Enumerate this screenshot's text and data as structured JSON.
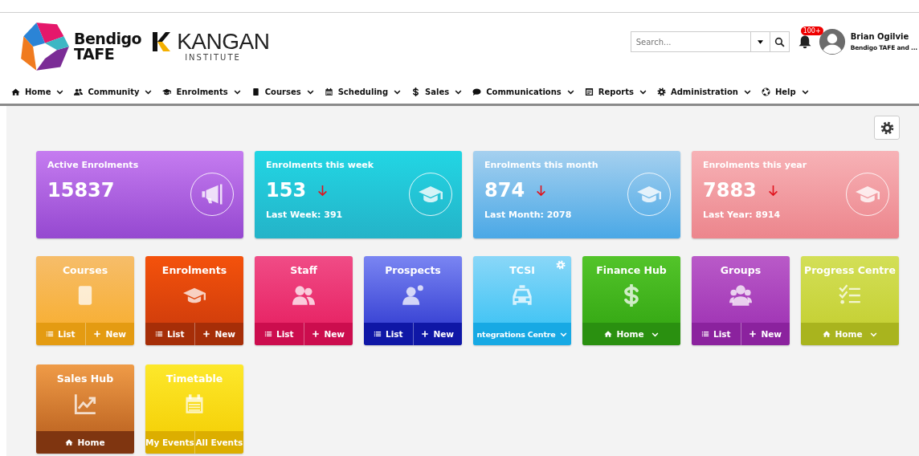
{
  "header": {
    "brand_primary": [
      "Bendigo",
      "TAFE"
    ],
    "brand_secondary": {
      "name": "KANGAN",
      "sub": "INSTITUTE"
    },
    "search": {
      "placeholder": "Search..."
    },
    "notifications": {
      "badge": "100+"
    },
    "user": {
      "name": "Brian Ogilvie",
      "organisation": "Bendigo TAFE and ..."
    }
  },
  "nav": [
    {
      "label": "Home"
    },
    {
      "label": "Community"
    },
    {
      "label": "Enrolments"
    },
    {
      "label": "Courses"
    },
    {
      "label": "Scheduling"
    },
    {
      "label": "Sales"
    },
    {
      "label": "Communications"
    },
    {
      "label": "Reports"
    },
    {
      "label": "Administration"
    },
    {
      "label": "Help"
    }
  ],
  "stats": [
    {
      "title": "Active Enrolments",
      "value": "15837",
      "falling": false
    },
    {
      "title": "Enrolments this week",
      "value": "153",
      "falling": true,
      "previous": "Last Week: 391"
    },
    {
      "title": "Enrolments this month",
      "value": "874",
      "falling": true,
      "previous": "Last Month: 2078"
    },
    {
      "title": "Enrolments this year",
      "value": "7883",
      "falling": true,
      "previous": "Last Year: 8914"
    }
  ],
  "tiles": [
    {
      "title": "Courses",
      "settings": false,
      "actions": [
        {
          "kind": "list",
          "label": "List"
        },
        {
          "kind": "new",
          "label": "New"
        }
      ]
    },
    {
      "title": "Enrolments",
      "settings": false,
      "actions": [
        {
          "kind": "list",
          "label": "List"
        },
        {
          "kind": "new",
          "label": "New"
        }
      ]
    },
    {
      "title": "Staff",
      "settings": false,
      "actions": [
        {
          "kind": "list",
          "label": "List"
        },
        {
          "kind": "new",
          "label": "New"
        }
      ]
    },
    {
      "title": "Prospects",
      "settings": false,
      "actions": [
        {
          "kind": "list",
          "label": "List"
        },
        {
          "kind": "new",
          "label": "New"
        }
      ]
    },
    {
      "title": "TCSI",
      "settings": true,
      "actions": [
        {
          "kind": "menu",
          "label": "ntegrations Centre"
        }
      ]
    },
    {
      "title": "Finance Hub",
      "settings": false,
      "actions": [
        {
          "kind": "home-menu",
          "label": "Home"
        }
      ]
    },
    {
      "title": "Groups",
      "settings": false,
      "actions": [
        {
          "kind": "list",
          "label": "List"
        },
        {
          "kind": "new",
          "label": "New"
        }
      ]
    },
    {
      "title": "Progress Centre",
      "settings": false,
      "actions": [
        {
          "kind": "home-menu",
          "label": "Home"
        }
      ]
    },
    {
      "title": "Sales Hub",
      "settings": false,
      "actions": [
        {
          "kind": "home",
          "label": "Home"
        }
      ]
    },
    {
      "title": "Timetable",
      "settings": false,
      "actions": [
        {
          "kind": "plain",
          "label": "My Events"
        },
        {
          "kind": "plain",
          "label": "All Events"
        }
      ]
    }
  ]
}
